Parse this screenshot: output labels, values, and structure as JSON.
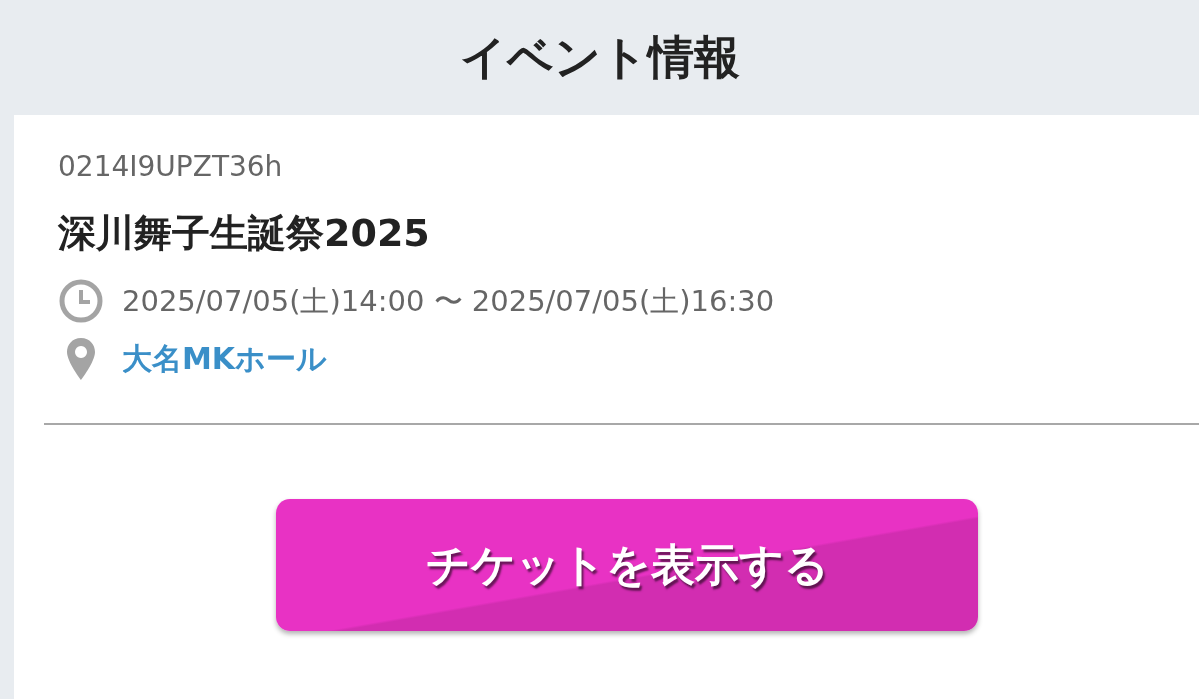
{
  "header": {
    "title": "イベント情報"
  },
  "event": {
    "code": "0214I9UPZT36h",
    "name": "深川舞子生誕祭2025",
    "datetime": "2025/07/05(土)14:00 〜 2025/07/05(土)16:30",
    "venue": "大名MKホール"
  },
  "action_button": {
    "label": "チケットを表示する"
  }
}
